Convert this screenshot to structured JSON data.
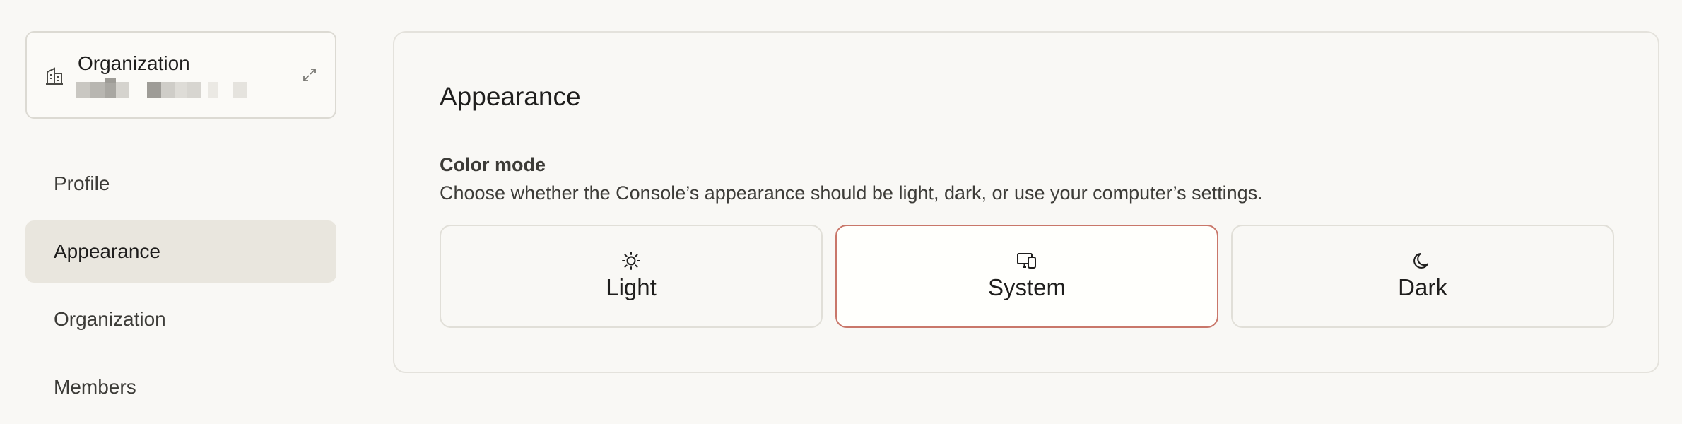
{
  "sidebar": {
    "org_card": {
      "name": "Organization"
    },
    "items": [
      {
        "label": "Profile"
      },
      {
        "label": "Appearance",
        "active": true
      },
      {
        "label": "Organization"
      },
      {
        "label": "Members"
      }
    ]
  },
  "main": {
    "title": "Appearance",
    "color_mode": {
      "label": "Color mode",
      "description": "Choose whether the Console’s appearance should be light, dark, or use your computer’s settings.",
      "options": [
        {
          "label": "Light",
          "icon": "sun-icon"
        },
        {
          "label": "System",
          "icon": "devices-icon",
          "selected": true
        },
        {
          "label": "Dark",
          "icon": "moon-icon"
        }
      ]
    }
  },
  "colors": {
    "background": "#f9f8f5",
    "active_nav": "#e9e6de",
    "selected_border": "#c9776a"
  }
}
